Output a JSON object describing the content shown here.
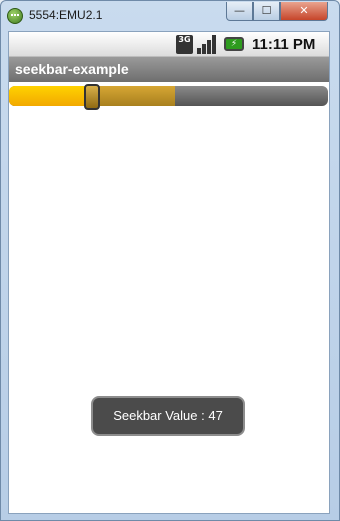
{
  "window": {
    "title": "5554:EMU2.1",
    "minimize_label": "—",
    "maximize_label": "☐",
    "close_label": "✕"
  },
  "statusbar": {
    "network_type": "3G",
    "time": "11:11 PM",
    "battery_icon": "battery-charging-icon",
    "signal_icon": "signal-icon"
  },
  "app": {
    "title": "seekbar-example"
  },
  "seekbar": {
    "progress": 0.26,
    "secondary_progress": 0.52
  },
  "toast": {
    "text": "Seekbar Value : 47"
  },
  "colors": {
    "accent": "#f2a900",
    "secondary": "#c89a2a"
  }
}
